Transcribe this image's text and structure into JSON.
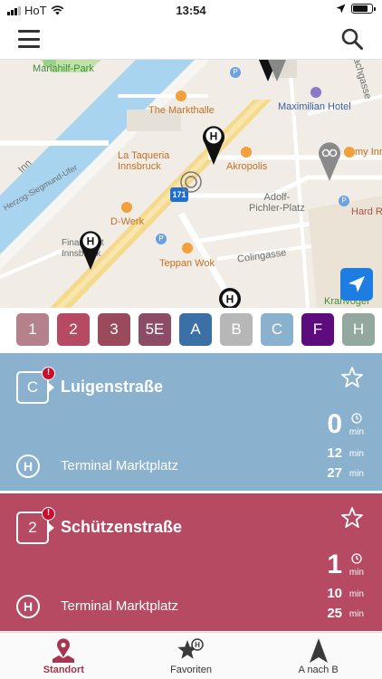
{
  "status_bar": {
    "carrier": "HoT",
    "time": "13:54",
    "icons": [
      "signal-bars-icon",
      "wifi-icon",
      "location-arrow-icon",
      "battery-icon"
    ],
    "battery_level": 0.8
  },
  "navbar": {
    "menu_icon": "hamburger-menu-icon",
    "search_icon": "search-icon"
  },
  "map": {
    "labels": {
      "park": "Mariahilf-Park",
      "markthalle": "The Markthalle",
      "maximilian": "Maximilian Hotel",
      "taqueria": "La Taqueria\nInnsbruck",
      "akropolis": "Akropolis",
      "myinn": "my Inn",
      "inn": "Inn",
      "ufer": "Herzog-Siegmund-Ufer",
      "dwerk": "D-Werk",
      "adolf": "Adolf-\nPichler-Platz",
      "hardrock": "Hard Ro",
      "finanzamt": "Finanzamt\nInnsbruck",
      "teppan": "Teppan Wok",
      "colingasse": "Colingasse",
      "krahvogel": "Krahvogel",
      "jachgasse": "Jachgasse",
      "route": "171"
    },
    "locate_icon": "navigation-arrow-icon",
    "stop_marker_letter": "H"
  },
  "line_chips": [
    {
      "label": "1",
      "color": "#b4818c"
    },
    {
      "label": "2",
      "color": "#b64a63"
    },
    {
      "label": "3",
      "color": "#9a4a5a"
    },
    {
      "label": "5E",
      "color": "#8c4b67"
    },
    {
      "label": "A",
      "color": "#3a70a6"
    },
    {
      "label": "B",
      "color": "#b7b7b7"
    },
    {
      "label": "C",
      "color": "#8ab2cf"
    },
    {
      "label": "F",
      "color": "#5c0c7d"
    },
    {
      "label": "H",
      "color": "#93a89f"
    }
  ],
  "departures": [
    {
      "line": "C",
      "alert": "!",
      "destination": "Luigenstraße",
      "stop_letter": "H",
      "stop": "Terminal Marktplatz",
      "times": [
        {
          "value": "0",
          "unit": "min"
        },
        {
          "value": "12",
          "unit": "min"
        },
        {
          "value": "27",
          "unit": "min"
        }
      ],
      "color": "#8ab2cf"
    },
    {
      "line": "2",
      "alert": "!",
      "destination": "Schützenstraße",
      "stop_letter": "H",
      "stop": "Terminal Marktplatz",
      "times": [
        {
          "value": "1",
          "unit": "min"
        },
        {
          "value": "10",
          "unit": "min"
        },
        {
          "value": "25",
          "unit": "min"
        }
      ],
      "color": "#b64a63"
    }
  ],
  "tabs": [
    {
      "label": "Standort",
      "icon": "map-pin-icon",
      "active": true
    },
    {
      "label": "Favoriten",
      "icon": "star-stop-icon",
      "active": false
    },
    {
      "label": "A nach B",
      "icon": "direction-arrow-icon",
      "active": false
    }
  ],
  "colors": {
    "accent": "#a8344f",
    "locate_button": "#1e7de0"
  }
}
